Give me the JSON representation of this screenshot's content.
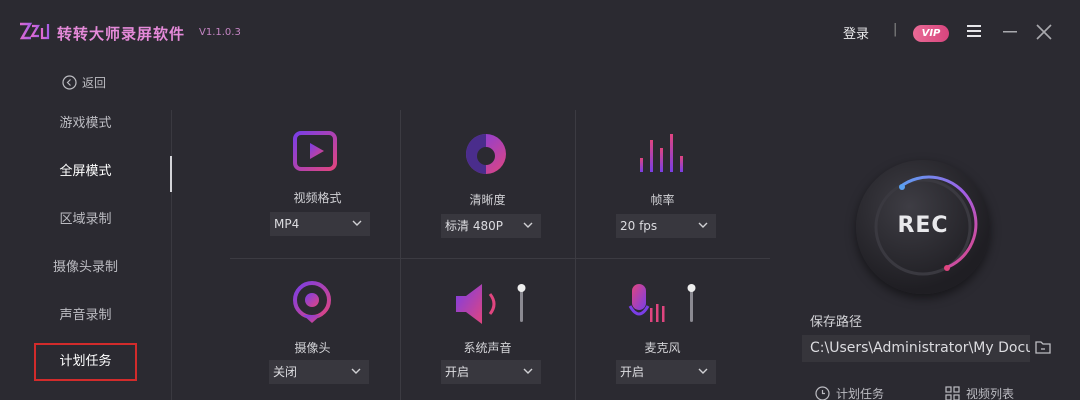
{
  "app": {
    "logo": "Z2d",
    "name": "转转大师录屏软件",
    "version": "V1.1.0.3"
  },
  "header": {
    "login": "登录",
    "separator": "|",
    "vip": "VIP",
    "icons": [
      "menu-icon",
      "minimize-icon",
      "close-icon"
    ]
  },
  "sidebar": {
    "back": "返回",
    "items": [
      {
        "label": "游戏模式",
        "state": "normal"
      },
      {
        "label": "全屏模式",
        "state": "active"
      },
      {
        "label": "区域录制",
        "state": "normal"
      },
      {
        "label": "摄像头录制",
        "state": "normal"
      },
      {
        "label": "声音录制",
        "state": "normal"
      },
      {
        "label": "计划任务",
        "state": "highlighted"
      }
    ]
  },
  "settings": [
    {
      "label": "视频格式",
      "value": "MP4",
      "icon": "video-format-icon"
    },
    {
      "label": "清晰度",
      "value": "标清 480P",
      "icon": "clarity-icon"
    },
    {
      "label": "帧率",
      "value": "20 fps",
      "icon": "framerate-icon"
    },
    {
      "label": "摄像头",
      "value": "关闭",
      "icon": "camera-icon"
    },
    {
      "label": "系统声音",
      "value": "开启",
      "icon": "speaker-icon"
    },
    {
      "label": "麦克风",
      "value": "开启",
      "icon": "microphone-icon"
    }
  ],
  "rec": {
    "label": "REC"
  },
  "save": {
    "label": "保存路径",
    "path": "C:\\Users\\Administrator\\My Documents"
  },
  "bottom": {
    "schedule": "计划任务",
    "video_list": "视频列表"
  },
  "colors": {
    "background": "#2b2a31",
    "accent_pink": "#e0457f",
    "accent_purple": "#7a3ee6",
    "highlight_border": "#d22b2b"
  }
}
